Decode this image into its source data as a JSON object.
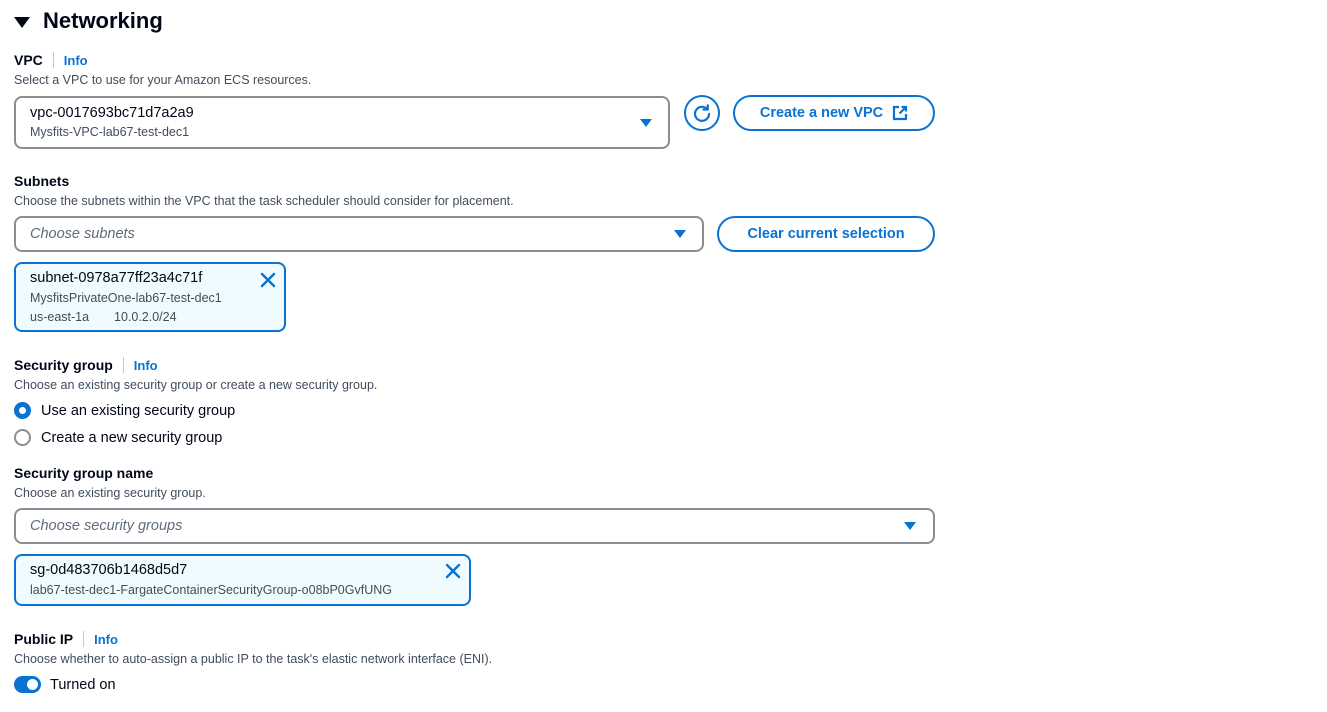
{
  "section": {
    "title": "Networking",
    "expanded": true
  },
  "vpc": {
    "label": "VPC",
    "info": "Info",
    "description": "Select a VPC to use for your Amazon ECS resources.",
    "selected_id": "vpc-0017693bc71d7a2a9",
    "selected_name": "Mysfits-VPC-lab67-test-dec1",
    "refresh_icon": "refresh-icon",
    "create_button": "Create a new VPC",
    "create_button_icon": "external-link-icon"
  },
  "subnets": {
    "label": "Subnets",
    "description": "Choose the subnets within the VPC that the task scheduler should consider for placement.",
    "placeholder": "Choose subnets",
    "clear_button": "Clear current selection",
    "tokens": [
      {
        "id": "subnet-0978a77ff23a4c71f",
        "name": "MysfitsPrivateOne-lab67-test-dec1",
        "az": "us-east-1a",
        "cidr": "10.0.2.0/24"
      }
    ]
  },
  "security_group": {
    "label": "Security group",
    "info": "Info",
    "description": "Choose an existing security group or create a new security group.",
    "options": [
      {
        "label": "Use an existing security group",
        "checked": true
      },
      {
        "label": "Create a new security group",
        "checked": false
      }
    ]
  },
  "security_group_name": {
    "label": "Security group name",
    "description": "Choose an existing security group.",
    "placeholder": "Choose security groups",
    "tokens": [
      {
        "id": "sg-0d483706b1468d5d7",
        "name": "lab67-test-dec1-FargateContainerSecurityGroup-o08bP0GvfUNG"
      }
    ]
  },
  "public_ip": {
    "label": "Public IP",
    "info": "Info",
    "description": "Choose whether to auto-assign a public IP to the task's elastic network interface (ENI).",
    "toggle_on": true,
    "toggle_label": "Turned on"
  },
  "colors": {
    "accent": "#0972d3",
    "text": "#000716",
    "secondary_text": "#414d5c",
    "border": "#8c8c94",
    "token_bg": "#f0fbff"
  }
}
